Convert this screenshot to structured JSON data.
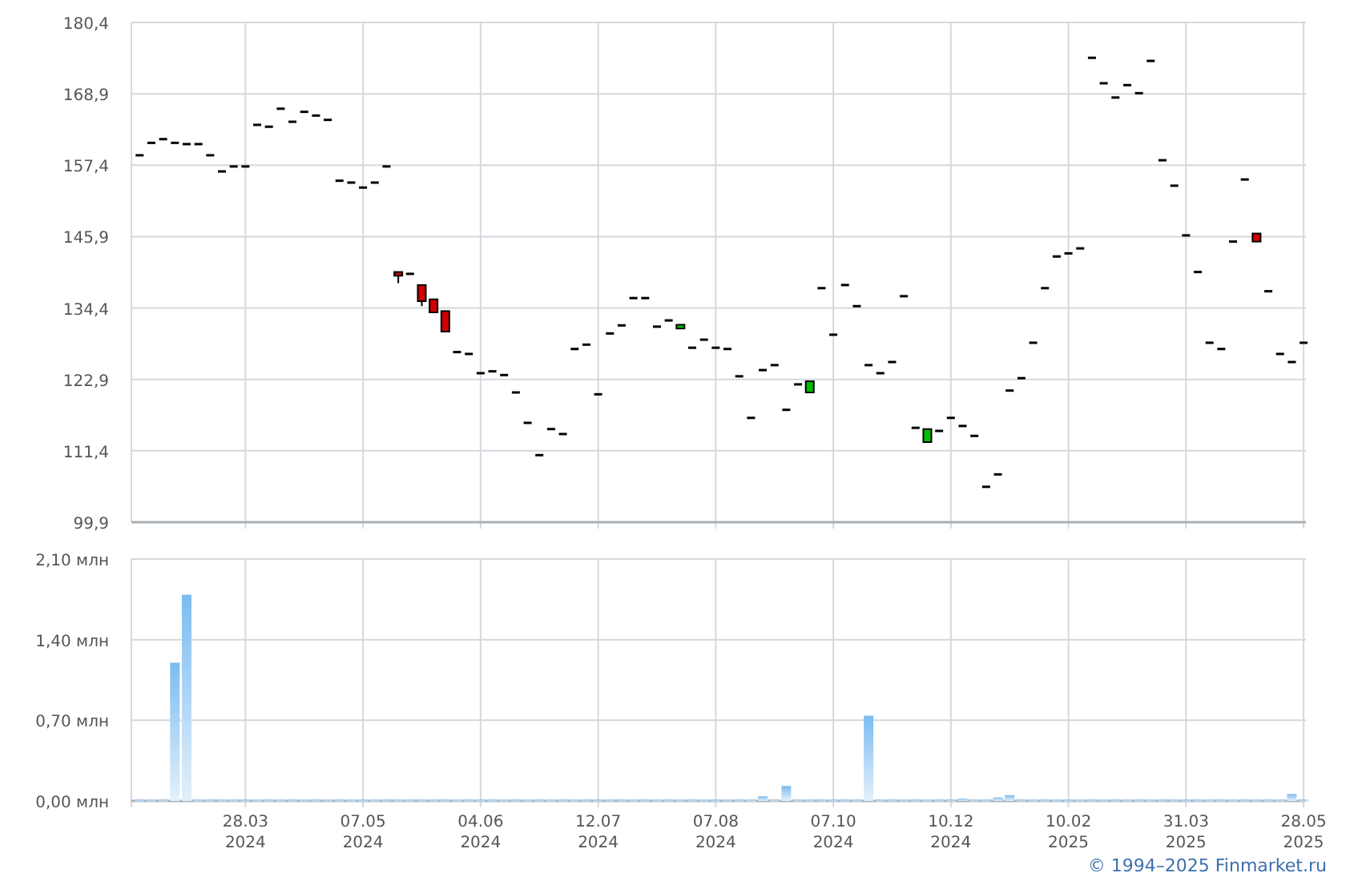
{
  "price_chart": {
    "chart_data": {
      "type": "candlestick",
      "categories": [
        null,
        null,
        null,
        null,
        null,
        null,
        null,
        null,
        null,
        null,
        null,
        null,
        null,
        null,
        null,
        null,
        null,
        null,
        null,
        null,
        null,
        null,
        null,
        null,
        null,
        null,
        null,
        null,
        null,
        null,
        null,
        null,
        null,
        null,
        null,
        null,
        null,
        null,
        null,
        null,
        null,
        null,
        null,
        null,
        null,
        null,
        null,
        null,
        null,
        null,
        null,
        null,
        null,
        null,
        null,
        null,
        null,
        null,
        null,
        null,
        null,
        null,
        null,
        null,
        null,
        null,
        null,
        null,
        null,
        null,
        null,
        null,
        null,
        null,
        null,
        null,
        null,
        null,
        null,
        null,
        null,
        null,
        null,
        null,
        null,
        null,
        null,
        null,
        null,
        null,
        null,
        null,
        null,
        null,
        null,
        null,
        null,
        null,
        null,
        null
      ],
      "grid": true,
      "ylim": [
        99.9,
        180.4
      ],
      "yticks": [
        {
          "value": 99.9,
          "label": "99,9"
        },
        {
          "value": 111.4,
          "label": "111,4"
        },
        {
          "value": 122.9,
          "label": "122,9"
        },
        {
          "value": 134.4,
          "label": "134,4"
        },
        {
          "value": 145.9,
          "label": "145,9"
        },
        {
          "value": 157.4,
          "label": "157,4"
        },
        {
          "value": 168.9,
          "label": "168,9"
        },
        {
          "value": 180.4,
          "label": "180,4"
        }
      ],
      "ohlc": [
        [
          159.0,
          159.0,
          159.0,
          159.0
        ],
        [
          161.0,
          161.0,
          161.0,
          161.0
        ],
        [
          161.6,
          161.6,
          161.6,
          161.6
        ],
        [
          161.0,
          161.0,
          161.0,
          161.0
        ],
        [
          160.8,
          160.8,
          160.8,
          160.8
        ],
        [
          160.8,
          160.8,
          160.8,
          160.8
        ],
        [
          159.0,
          159.0,
          159.0,
          159.0
        ],
        [
          156.4,
          156.4,
          156.4,
          156.4
        ],
        [
          157.2,
          157.2,
          157.2,
          157.2
        ],
        [
          157.2,
          157.2,
          157.2,
          157.2
        ],
        [
          163.9,
          163.9,
          163.9,
          163.9
        ],
        [
          163.6,
          163.6,
          163.6,
          163.6
        ],
        [
          166.5,
          166.5,
          166.5,
          166.5
        ],
        [
          164.4,
          164.4,
          164.4,
          164.4
        ],
        [
          166.0,
          166.0,
          166.0,
          166.0
        ],
        [
          165.4,
          165.4,
          165.4,
          165.4
        ],
        [
          164.7,
          164.7,
          164.7,
          164.7
        ],
        [
          154.9,
          154.9,
          154.9,
          154.9
        ],
        [
          154.6,
          154.6,
          154.6,
          154.6
        ],
        [
          153.8,
          153.8,
          153.8,
          153.8
        ],
        [
          154.6,
          154.6,
          154.6,
          154.6
        ],
        [
          157.2,
          157.2,
          157.2,
          157.2
        ],
        [
          140.2,
          140.2,
          138.4,
          139.6
        ],
        [
          139.9,
          139.9,
          139.9,
          139.9
        ],
        [
          138.1,
          138.1,
          134.7,
          135.5
        ],
        [
          135.8,
          135.8,
          133.7,
          133.7
        ],
        [
          133.9,
          133.9,
          130.6,
          130.6
        ],
        [
          127.3,
          127.3,
          127.3,
          127.3
        ],
        [
          127.0,
          127.0,
          127.0,
          127.0
        ],
        [
          123.9,
          123.9,
          123.9,
          123.9
        ],
        [
          124.2,
          124.2,
          124.2,
          124.2
        ],
        [
          123.6,
          123.6,
          123.6,
          123.6
        ],
        [
          120.8,
          120.8,
          120.8,
          120.8
        ],
        [
          115.9,
          115.9,
          115.9,
          115.9
        ],
        [
          110.7,
          110.7,
          110.7,
          110.7
        ],
        [
          114.9,
          114.9,
          114.9,
          114.9
        ],
        [
          114.1,
          114.1,
          114.1,
          114.1
        ],
        [
          127.8,
          127.8,
          127.8,
          127.8
        ],
        [
          128.5,
          128.5,
          128.5,
          128.5
        ],
        [
          120.5,
          120.5,
          120.5,
          120.5
        ],
        [
          130.3,
          130.3,
          130.3,
          130.3
        ],
        [
          131.6,
          131.6,
          131.6,
          131.6
        ],
        [
          136.0,
          136.0,
          136.0,
          136.0
        ],
        [
          136.0,
          136.0,
          136.0,
          136.0
        ],
        [
          131.4,
          131.4,
          131.4,
          131.4
        ],
        [
          132.4,
          132.4,
          132.4,
          132.4
        ],
        [
          131.1,
          131.7,
          131.1,
          131.7
        ],
        [
          128.0,
          128.0,
          128.0,
          128.0
        ],
        [
          129.3,
          129.3,
          129.3,
          129.3
        ],
        [
          128.0,
          128.0,
          128.0,
          128.0
        ],
        [
          127.8,
          127.8,
          127.8,
          127.8
        ],
        [
          123.4,
          123.4,
          123.4,
          123.4
        ],
        [
          116.7,
          116.7,
          116.7,
          116.7
        ],
        [
          124.4,
          124.4,
          124.4,
          124.4
        ],
        [
          125.2,
          125.2,
          125.2,
          125.2
        ],
        [
          118.0,
          118.0,
          118.0,
          118.0
        ],
        [
          122.1,
          122.1,
          122.1,
          122.1
        ],
        [
          120.8,
          122.6,
          120.8,
          122.6
        ],
        [
          137.6,
          137.6,
          137.6,
          137.6
        ],
        [
          130.1,
          130.1,
          130.1,
          130.1
        ],
        [
          138.1,
          138.1,
          138.1,
          138.1
        ],
        [
          134.7,
          134.7,
          134.7,
          134.7
        ],
        [
          125.2,
          125.2,
          125.2,
          125.2
        ],
        [
          123.9,
          123.9,
          123.9,
          123.9
        ],
        [
          125.7,
          125.7,
          125.7,
          125.7
        ],
        [
          136.3,
          136.3,
          136.3,
          136.3
        ],
        [
          115.1,
          115.1,
          115.1,
          115.1
        ],
        [
          112.8,
          114.9,
          112.8,
          114.9
        ],
        [
          114.6,
          114.6,
          114.6,
          114.6
        ],
        [
          116.7,
          116.7,
          116.7,
          116.7
        ],
        [
          115.4,
          115.4,
          115.4,
          115.4
        ],
        [
          113.8,
          113.8,
          113.8,
          113.8
        ],
        [
          105.6,
          105.6,
          105.6,
          105.6
        ],
        [
          107.6,
          107.6,
          107.6,
          107.6
        ],
        [
          121.1,
          121.1,
          121.1,
          121.1
        ],
        [
          123.1,
          123.1,
          123.1,
          123.1
        ],
        [
          128.8,
          128.8,
          128.8,
          128.8
        ],
        [
          137.6,
          137.6,
          137.6,
          137.6
        ],
        [
          142.7,
          142.7,
          142.7,
          142.7
        ],
        [
          143.2,
          143.2,
          143.2,
          143.2
        ],
        [
          144.0,
          144.0,
          144.0,
          144.0
        ],
        [
          174.7,
          174.7,
          174.7,
          174.7
        ],
        [
          170.6,
          170.6,
          170.6,
          170.6
        ],
        [
          168.3,
          168.3,
          168.3,
          168.3
        ],
        [
          170.3,
          170.3,
          170.3,
          170.3
        ],
        [
          169.0,
          169.0,
          169.0,
          169.0
        ],
        [
          174.2,
          174.2,
          174.2,
          174.2
        ],
        [
          158.2,
          158.2,
          158.2,
          158.2
        ],
        [
          154.1,
          154.1,
          154.1,
          154.1
        ],
        [
          146.1,
          146.1,
          146.1,
          146.1
        ],
        [
          140.2,
          140.2,
          140.2,
          140.2
        ],
        [
          128.8,
          128.8,
          128.8,
          128.8
        ],
        [
          127.8,
          127.8,
          127.8,
          127.8
        ],
        [
          145.1,
          145.1,
          145.1,
          145.1
        ],
        [
          155.1,
          155.1,
          155.1,
          155.1
        ],
        [
          146.4,
          146.4,
          145.1,
          145.1
        ],
        [
          137.1,
          137.1,
          137.1,
          137.1
        ],
        [
          127.0,
          127.0,
          127.0,
          127.0
        ],
        [
          125.7,
          125.7,
          125.7,
          125.7
        ],
        [
          128.8,
          128.8,
          128.8,
          128.8
        ]
      ]
    }
  },
  "volume_chart": {
    "chart_data": {
      "type": "bar",
      "grid": true,
      "categories": [
        null,
        null,
        null,
        null,
        null,
        null,
        null,
        null,
        null,
        "28.03 2024",
        null,
        null,
        null,
        null,
        null,
        null,
        null,
        null,
        null,
        "07.05 2024",
        null,
        null,
        null,
        null,
        null,
        null,
        null,
        null,
        null,
        "04.06 2024",
        null,
        null,
        null,
        null,
        null,
        null,
        null,
        null,
        null,
        "12.07 2024",
        null,
        null,
        null,
        null,
        null,
        null,
        null,
        null,
        null,
        "07.08 2024",
        null,
        null,
        null,
        null,
        null,
        null,
        null,
        null,
        null,
        "07.10 2024",
        null,
        null,
        null,
        null,
        null,
        null,
        null,
        null,
        null,
        "10.12 2024",
        null,
        null,
        null,
        null,
        null,
        null,
        null,
        null,
        null,
        "10.02 2025",
        null,
        null,
        null,
        null,
        null,
        null,
        null,
        null,
        null,
        "31.03 2025",
        null,
        null,
        null,
        null,
        null,
        null,
        null,
        null,
        null,
        "28.05 2025"
      ],
      "ylim": [
        0,
        2.1
      ],
      "yticks": [
        {
          "value": 0,
          "label": "0,00 млн"
        },
        {
          "value": 0.7,
          "label": "0,70 млн"
        },
        {
          "value": 1.4,
          "label": "1,40 млн"
        },
        {
          "value": 2.1,
          "label": "2,10 млн"
        }
      ],
      "series": [
        {
          "color": "#7bbcf0",
          "values": [
            0.01,
            0.01,
            0.01,
            1.2,
            1.79,
            0.01,
            0.01,
            0.01,
            0.01,
            0.01,
            0.01,
            0.01,
            0.01,
            0.01,
            0.01,
            0.01,
            0.01,
            0.01,
            0.01,
            0.01,
            0.01,
            0.01,
            0.01,
            0.01,
            0.01,
            0.01,
            0.01,
            0.01,
            0.01,
            0.01,
            0.01,
            0.01,
            0.01,
            0.01,
            0.01,
            0.01,
            0.01,
            0.01,
            0.01,
            0.01,
            0.01,
            0.01,
            0.01,
            0.01,
            0.01,
            0.01,
            0.01,
            0.01,
            0.01,
            0.01,
            0.01,
            0.01,
            0.01,
            0.04,
            0.01,
            0.13,
            0.01,
            0.01,
            0.01,
            0.01,
            0.01,
            0.01,
            0.74,
            0.01,
            0.01,
            0.01,
            0.01,
            0.01,
            0.01,
            0.01,
            0.02,
            0.01,
            0.01,
            0.03,
            0.05,
            0.01,
            0.01,
            0.01,
            0.01,
            0.01,
            0.01,
            0.01,
            0.01,
            0.01,
            0.01,
            0.01,
            0.01,
            0.01,
            0.01,
            0.01,
            0.01,
            0.01,
            0.01,
            0.01,
            0.01,
            0.01,
            0.01,
            0.01,
            0.06,
            0.01
          ]
        }
      ]
    }
  },
  "footer": {
    "copyright": "© 1994–2025 Finmarket.ru"
  }
}
